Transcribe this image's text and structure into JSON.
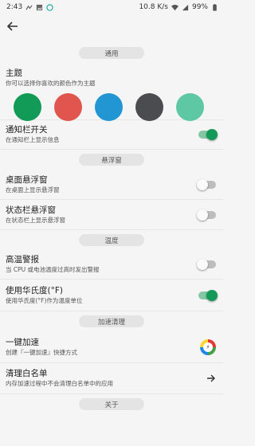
{
  "status_bar": {
    "time": "2:43",
    "speed": "10.8 K/s",
    "battery": "99%",
    "icons": [
      "signal-icon",
      "image-icon",
      "app-icon",
      "wifi-icon",
      "cell-signal-icon",
      "battery-icon"
    ]
  },
  "toolbar": {
    "back_icon": "arrow-left-icon"
  },
  "sections": {
    "general": "通用",
    "floating": "悬浮窗",
    "temperature": "温度",
    "boost": "加速清理",
    "about": "关于"
  },
  "theme": {
    "title": "主题",
    "subtitle": "你可以选择你喜欢的颜色作为主题",
    "colors": [
      "#129a57",
      "#e0564f",
      "#2196d3",
      "#4a4c4f",
      "#5ec8a4"
    ]
  },
  "notification_bar": {
    "title": "通知栏开关",
    "subtitle": "在通知栏上显示信息",
    "on": true
  },
  "desktop_float": {
    "title": "桌面悬浮窗",
    "subtitle": "在桌面上显示悬浮窗",
    "on": false
  },
  "statusbar_float": {
    "title": "状态栏悬浮窗",
    "subtitle": "在状态栏上显示悬浮窗",
    "on": false
  },
  "high_temp": {
    "title": "高温警报",
    "subtitle": "当 CPU 或电池温度过高时发出警报",
    "on": false
  },
  "fahrenheit": {
    "title": "使用华氏度(°F)",
    "subtitle": "使用华氏度(°F)作为温度单位",
    "on": true
  },
  "one_key_boost": {
    "title": "一键加速",
    "subtitle": "创建『一键加速』快捷方式"
  },
  "whitelist": {
    "title": "清理白名单",
    "subtitle": "内存加速过程中不会清理白名单中的应用"
  }
}
